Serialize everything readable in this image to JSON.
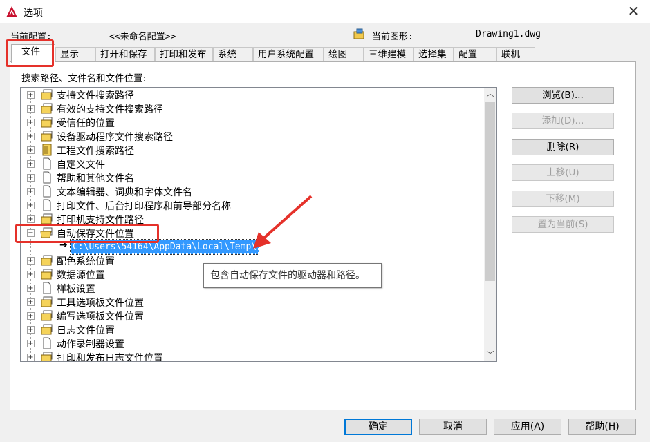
{
  "window": {
    "title": "选项"
  },
  "config": {
    "current_profile_label": "当前配置:",
    "current_profile_value": "<<未命名配置>>",
    "current_drawing_label": "当前图形:",
    "current_drawing_value": "Drawing1.dwg"
  },
  "tabs": [
    {
      "label": "文件",
      "active": true
    },
    {
      "label": "显示"
    },
    {
      "label": "打开和保存"
    },
    {
      "label": "打印和发布"
    },
    {
      "label": "系统"
    },
    {
      "label": "用户系统配置"
    },
    {
      "label": "绘图"
    },
    {
      "label": "三维建模"
    },
    {
      "label": "选择集"
    },
    {
      "label": "配置"
    },
    {
      "label": "联机"
    }
  ],
  "files_tab": {
    "section_label": "搜索路径、文件名和文件位置:",
    "tree_items": [
      {
        "label": "支持文件搜索路径",
        "icon": "folder-stack-icon",
        "expanded": false
      },
      {
        "label": "有效的支持文件搜索路径",
        "icon": "folder-stack-icon",
        "expanded": false
      },
      {
        "label": "受信任的位置",
        "icon": "folder-stack-icon",
        "expanded": false
      },
      {
        "label": "设备驱动程序文件搜索路径",
        "icon": "folder-stack-icon",
        "expanded": false
      },
      {
        "label": "工程文件搜索路径",
        "icon": "project-icon",
        "expanded": false
      },
      {
        "label": "自定义文件",
        "icon": "file-icon",
        "expanded": false
      },
      {
        "label": "帮助和其他文件名",
        "icon": "file-icon",
        "expanded": false
      },
      {
        "label": "文本编辑器、词典和字体文件名",
        "icon": "file-icon",
        "expanded": false
      },
      {
        "label": "打印文件、后台打印程序和前导部分名称",
        "icon": "file-icon",
        "expanded": false
      },
      {
        "label": "打印机支持文件路径",
        "icon": "folder-stack-icon",
        "expanded": false
      },
      {
        "label": "自动保存文件位置",
        "icon": "folder-stack-icon",
        "expanded": true,
        "children": [
          "C:\\Users\\54164\\AppData\\Local\\Temp\\"
        ]
      },
      {
        "label": "配色系统位置",
        "icon": "folder-stack-icon",
        "expanded": false
      },
      {
        "label": "数据源位置",
        "icon": "folder-stack-icon",
        "expanded": false
      },
      {
        "label": "样板设置",
        "icon": "file-icon",
        "expanded": false
      },
      {
        "label": "工具选项板文件位置",
        "icon": "folder-stack-icon",
        "expanded": false
      },
      {
        "label": "编写选项板文件位置",
        "icon": "folder-stack-icon",
        "expanded": false
      },
      {
        "label": "日志文件位置",
        "icon": "folder-stack-icon",
        "expanded": false
      },
      {
        "label": "动作录制器设置",
        "icon": "file-icon",
        "expanded": false
      },
      {
        "label": "打印和发布日志文件位置",
        "icon": "folder-stack-icon",
        "expanded": false
      }
    ],
    "tooltip": "包含自动保存文件的驱动器和路径。",
    "side_buttons": [
      {
        "label": "浏览(B)...",
        "enabled": true
      },
      {
        "label": "添加(D)...",
        "enabled": false
      },
      {
        "label": "删除(R)",
        "enabled": true
      },
      {
        "label": "上移(U)",
        "enabled": false
      },
      {
        "label": "下移(M)",
        "enabled": false
      },
      {
        "label": "置为当前(S)",
        "enabled": false
      }
    ]
  },
  "footer_buttons": {
    "ok": "确定",
    "cancel": "取消",
    "apply": "应用(A)",
    "help": "帮助(H)"
  },
  "colors": {
    "selection": "#3399ff",
    "annotation_red": "#e5312a",
    "default_button_border": "#0078d7"
  }
}
